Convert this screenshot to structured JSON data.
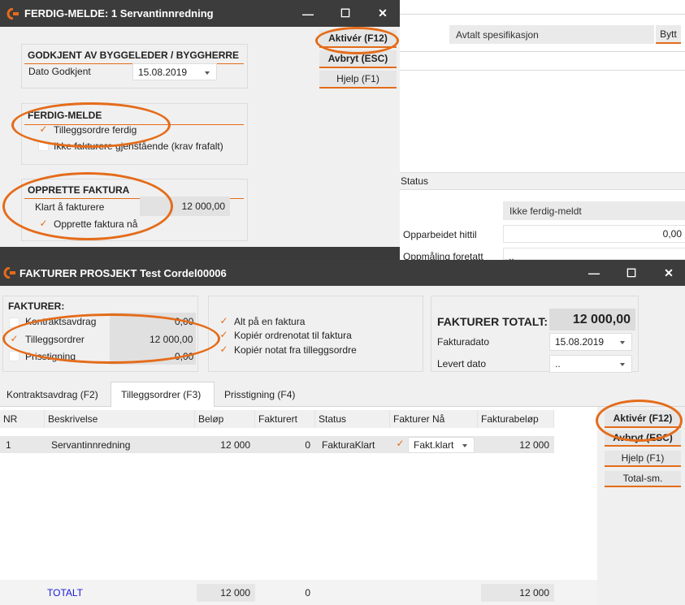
{
  "colors": {
    "accent": "#e46c1a",
    "titlebar": "#3c3c3c",
    "panel": "#f0f0f0"
  },
  "background_window": {
    "spec_field": "Avtalt spesifikasjon",
    "swap_button": "Bytt",
    "status_header": "Status",
    "status_value": "Ikke ferdig-meldt",
    "row1_label": "Opparbeidet hittil",
    "row1_value": "0,00",
    "row2_label": "Oppmåling foretatt",
    "row2_value": ".."
  },
  "dialog1": {
    "title": "FERDIG-MELDE:  1 Servantinnredning",
    "approve": {
      "title": "GODKJENT AV BYGGELEDER / BYGGHERRE",
      "date_label": "Dato Godkjent",
      "date_value": "15.08.2019"
    },
    "ferdig": {
      "title": "FERDIG-MELDE",
      "check1": "Tilleggsordre ferdig",
      "check2": "Ikke fakturere gjenstående (krav frafalt)"
    },
    "faktura": {
      "title": "OPPRETTE FAKTURA",
      "ready_label": "Klart å fakturere",
      "ready_value": "12 000,00",
      "check": "Opprette faktura nå"
    },
    "buttons": {
      "activate": "Aktivér (F12)",
      "cancel": "Avbryt (ESC)",
      "help": "Hjelp (F1)"
    }
  },
  "dialog2": {
    "title": "FAKTURER PROSJEKT Test Cordel00006",
    "fakturer": {
      "title": "FAKTURER:",
      "rows": [
        {
          "label": "Kontraktsavdrag",
          "value": "0,00"
        },
        {
          "label": "Tilleggsordrer",
          "value": "12 000,00"
        },
        {
          "label": "Prisstigning",
          "value": "0,00"
        }
      ]
    },
    "options": [
      "Alt på en faktura",
      "Kopiér ordrenotat til faktura",
      "Kopiér notat fra tilleggsordre"
    ],
    "totals": {
      "label": "FAKTURER TOTALT:",
      "value": "12 000,00",
      "date_label": "Fakturadato",
      "date_value": "15.08.2019",
      "delivered_label": "Levert dato",
      "delivered_value": ".."
    },
    "tabs": [
      "Kontraktsavdrag (F2)",
      "Tilleggsordrer (F3)",
      "Prisstigning (F4)"
    ],
    "table": {
      "columns": [
        "NR",
        "Beskrivelse",
        "Beløp",
        "Fakturert",
        "Status",
        "Fakturer Nå",
        "Fakturabeløp"
      ],
      "rows": [
        {
          "nr": "1",
          "desc": "Servantinnredning",
          "amount": "12 000",
          "invoiced": "0",
          "status": "FakturaKlart",
          "now": "Fakt.klart",
          "invoice_amount": "12 000"
        }
      ]
    },
    "totals_row": {
      "label": "TOTALT",
      "amount": "12 000",
      "invoiced": "0",
      "invoice_amount": "12 000"
    },
    "buttons": {
      "activate": "Aktivér (F12)",
      "cancel": "Avbryt (ESC)",
      "help": "Hjelp (F1)",
      "total": "Total-sm."
    }
  }
}
